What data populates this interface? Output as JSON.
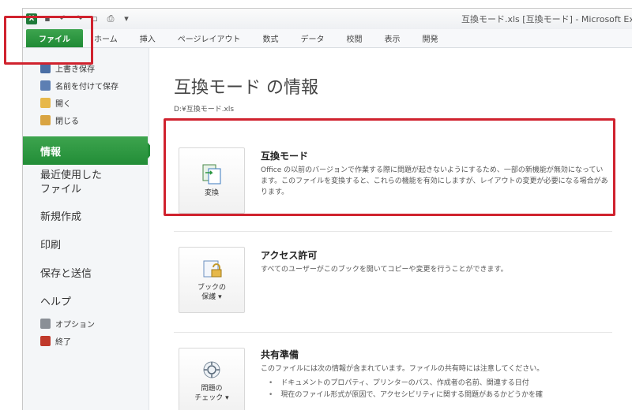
{
  "titlebar": {
    "title": "互換モード.xls [互換モード] - Microsoft Excel"
  },
  "ribbon": {
    "tabs": [
      {
        "label": "ファイル"
      },
      {
        "label": "ホーム"
      },
      {
        "label": "挿入"
      },
      {
        "label": "ページレイアウト"
      },
      {
        "label": "数式"
      },
      {
        "label": "データ"
      },
      {
        "label": "校閲"
      },
      {
        "label": "表示"
      },
      {
        "label": "開発"
      }
    ]
  },
  "nav": {
    "save": "上書き保存",
    "save_as": "名前を付けて保存",
    "open": "開く",
    "close": "閉じる",
    "info": "情報",
    "recent_line1": "最近使用した",
    "recent_line2": "ファイル",
    "new": "新規作成",
    "print": "印刷",
    "save_send": "保存と送信",
    "help": "ヘルプ",
    "options": "オプション",
    "exit": "終了"
  },
  "main": {
    "title": "互換モード の情報",
    "path": "D:¥互換モード.xls",
    "compat": {
      "button": "変換",
      "title": "互換モード",
      "desc": "Office の以前のバージョンで作業する際に問題が起きないようにするため、一部の新機能が無効になっています。このファイルを変換すると、これらの機能を有効にしますが、レイアウトの変更が必要になる場合があります。"
    },
    "permission": {
      "button_line1": "ブックの",
      "button_line2": "保護 ▾",
      "title": "アクセス許可",
      "desc": "すべてのユーザーがこのブックを開いてコピーや変更を行うことができます。"
    },
    "prepare": {
      "button_line1": "問題の",
      "button_line2": "チェック ▾",
      "title": "共有準備",
      "desc": "このファイルには次の情報が含まれています。ファイルの共有時には注意してください。",
      "bullets": [
        "ドキュメントのプロパティ、プリンターのパス、作成者の名前、関連する日付",
        "現在のファイル形式が原因で、アクセシビリティに関する問題があるかどうかを確"
      ]
    }
  },
  "colors": {
    "file_tab": "#2a9640",
    "annotation": "#d0222e"
  }
}
